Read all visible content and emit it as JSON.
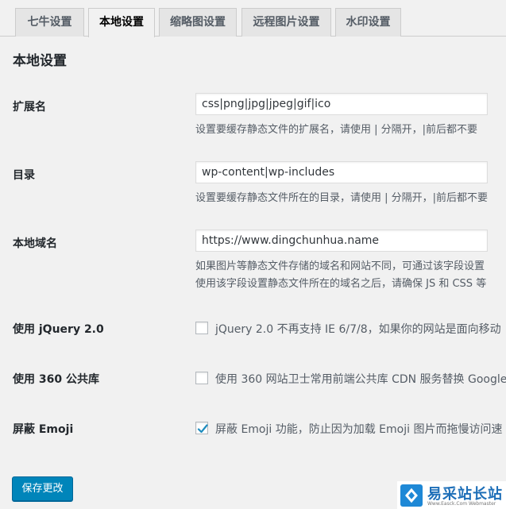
{
  "tabs": [
    {
      "label": "七牛设置"
    },
    {
      "label": "本地设置"
    },
    {
      "label": "缩略图设置"
    },
    {
      "label": "远程图片设置"
    },
    {
      "label": "水印设置"
    }
  ],
  "page_title": "本地设置",
  "fields": {
    "extension": {
      "label": "扩展名",
      "value": "css|png|jpg|jpeg|gif|ico",
      "desc": "设置要缓存静态文件的扩展名，请使用 | 分隔开，|前后都不要"
    },
    "directory": {
      "label": "目录",
      "value": "wp-content|wp-includes",
      "desc": "设置要缓存静态文件所在的目录，请使用 | 分隔开，|前后都不要"
    },
    "local_domain": {
      "label": "本地域名",
      "value": "https://www.dingchunhua.name",
      "desc1": "如果图片等静态文件存储的域名和网站不同，可通过该字段设置",
      "desc2": "使用该字段设置静态文件所在的域名之后，请确保 JS 和 CSS 等"
    }
  },
  "checkboxes": {
    "jquery": {
      "label": "使用 jQuery 2.0",
      "text": "jQuery 2.0 不再支持 IE 6/7/8，如果你的网站是面向移动",
      "checked": false
    },
    "cdn360": {
      "label": "使用 360 公共库",
      "text": "使用 360 网站卫士常用前端公共库 CDN 服务替换 Google",
      "checked": false
    },
    "emoji": {
      "label": "屏蔽 Emoji",
      "text": "屏蔽 Emoji 功能，防止因为加载 Emoji 图片而拖慢访问速",
      "checked": true
    }
  },
  "save_button": "保存更改",
  "watermark": {
    "title": "易采站长站",
    "subtitle": "Www.Easck.Com Webmaster"
  },
  "colors": {
    "accent": "#0085ba",
    "checkmark": "#1e8cbe"
  }
}
